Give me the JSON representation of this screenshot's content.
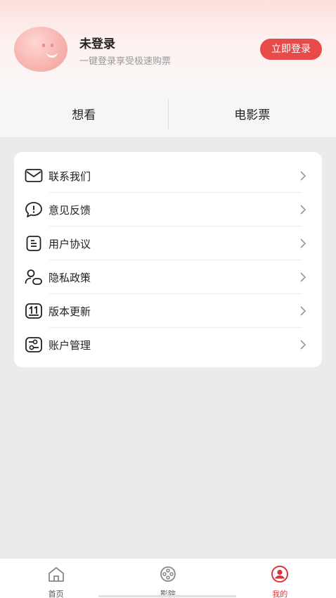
{
  "profile": {
    "name": "未登录",
    "subtitle": "一键登录享受极速购票",
    "login_label": "立即登录"
  },
  "colors": {
    "accent": "#e84a4a",
    "active_tab": "#d9343a",
    "page_bg": "#ebebeb"
  },
  "tabs": [
    {
      "label": "想看"
    },
    {
      "label": "电影票"
    }
  ],
  "menu": [
    {
      "label": "联系我们",
      "icon": "mail-icon"
    },
    {
      "label": "意见反馈",
      "icon": "feedback-icon"
    },
    {
      "label": "用户协议",
      "icon": "document-icon"
    },
    {
      "label": "隐私政策",
      "icon": "privacy-icon"
    },
    {
      "label": "版本更新",
      "icon": "update-icon"
    },
    {
      "label": "账户管理",
      "icon": "account-settings-icon"
    }
  ],
  "tabbar": [
    {
      "label": "首页",
      "icon": "home-icon",
      "active": false
    },
    {
      "label": "影院",
      "icon": "film-reel-icon",
      "active": false
    },
    {
      "label": "我的",
      "icon": "profile-icon",
      "active": true
    }
  ]
}
